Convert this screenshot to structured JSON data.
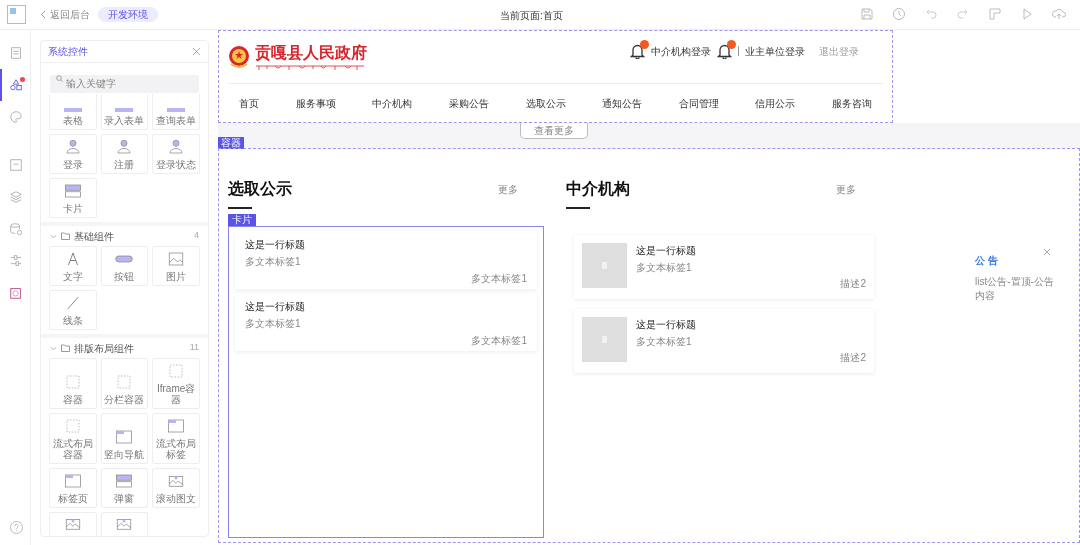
{
  "topbar": {
    "back": "返回后台",
    "env_badge": "开发环境",
    "current_page": "当前页面:首页"
  },
  "rail": [
    {
      "selected": false,
      "dot": false
    },
    {
      "selected": true,
      "dot": true
    },
    {
      "selected": false,
      "dot": false
    },
    {
      "selected": false,
      "dot": false
    },
    {
      "selected": false,
      "dot": false
    },
    {
      "selected": false,
      "dot": false
    },
    {
      "selected": false,
      "dot": false
    },
    {
      "selected": false,
      "dot": false
    }
  ],
  "panel": {
    "title": "系统控件",
    "search_placeholder": "输入关键字",
    "top_tiles": [
      "表格",
      "录入表单",
      "查询表单",
      "登录",
      "注册",
      "登录状态",
      "卡片"
    ],
    "sections": [
      {
        "name": "基础组件",
        "count": "4",
        "expanded": true,
        "tiles": [
          "文字",
          "按钮",
          "图片",
          "线条"
        ]
      },
      {
        "name": "排版布局组件",
        "count": "11",
        "expanded": true,
        "tiles": [
          "容器",
          "分栏容器",
          "Iframe容器",
          "流式布局容器",
          "竖向导航",
          "流式布局标签",
          "标签页",
          "弹窗",
          "滚动图文"
        ]
      }
    ],
    "clipped_tiles": [
      {
        "kind": "slide"
      },
      {
        "kind": "slide"
      }
    ]
  },
  "site": {
    "title": "贡嘎县人民政府",
    "links": [
      {
        "label": "中介机构登录",
        "muted": false
      },
      {
        "label": "业主单位登录",
        "muted": false
      },
      {
        "label": "退出登录",
        "muted": true
      }
    ],
    "nav": [
      "首页",
      "服务事项",
      "中介机构",
      "采购公告",
      "选取公示",
      "通知公告",
      "合同管理",
      "信用公示",
      "服务咨询"
    ],
    "more_button": "查看更多",
    "container_tag": "容器"
  },
  "columns": [
    {
      "title": "选取公示",
      "more": "更多",
      "card_tag": "卡片",
      "with_image": false,
      "items": [
        {
          "title": "这是一行标题",
          "subtitle": "多文本标签1",
          "note": "多文本标签1"
        },
        {
          "title": "这是一行标题",
          "subtitle": "多文本标签1",
          "note": "多文本标签1"
        }
      ]
    },
    {
      "title": "中介机构",
      "more": "更多",
      "with_image": true,
      "items": [
        {
          "title": "这是一行标题",
          "subtitle": "多文本标签1",
          "note": "描述2"
        },
        {
          "title": "这是一行标题",
          "subtitle": "多文本标签1",
          "note": "描述2"
        }
      ]
    }
  ],
  "notice": {
    "title": "公 告",
    "body": "list公告-置顶-公告内容"
  }
}
